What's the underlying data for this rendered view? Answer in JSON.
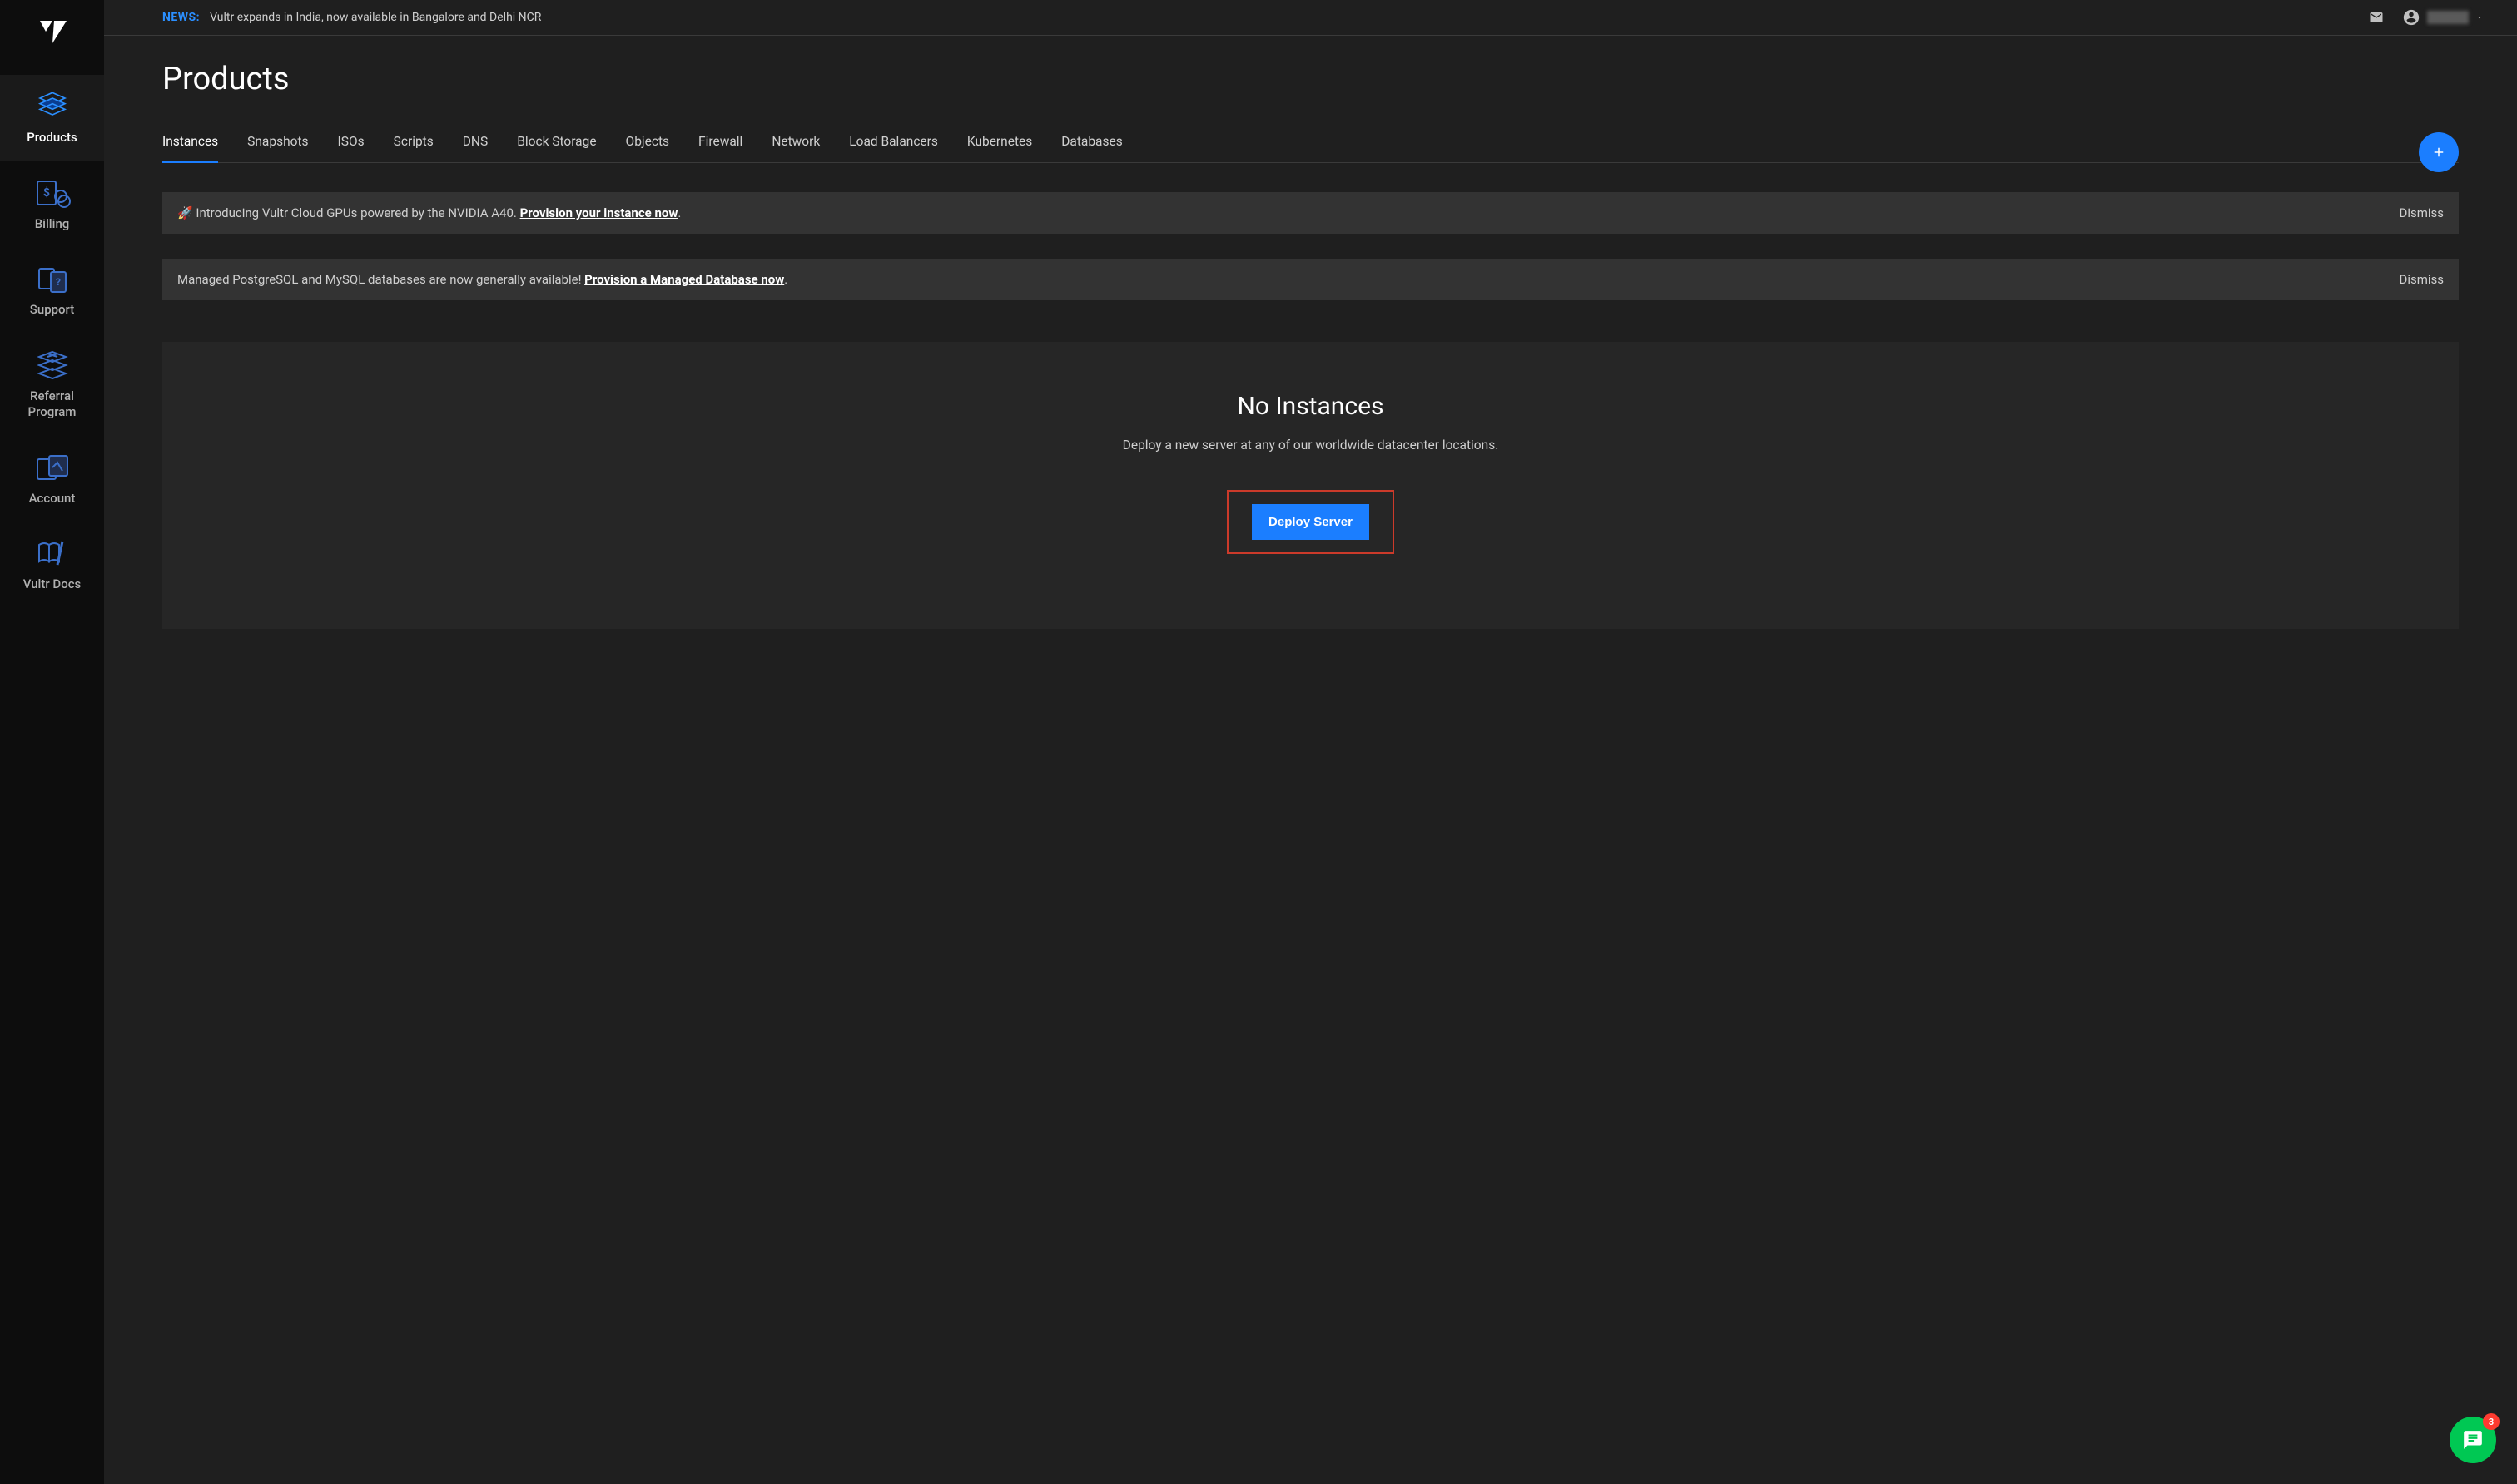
{
  "news": {
    "label": "NEWS:",
    "text": "Vultr expands in India, now available in Bangalore and Delhi NCR"
  },
  "page": {
    "title": "Products"
  },
  "sidebar": {
    "items": [
      {
        "label": "Products"
      },
      {
        "label": "Billing"
      },
      {
        "label": "Support"
      },
      {
        "label": "Referral Program"
      },
      {
        "label": "Account"
      },
      {
        "label": "Vultr Docs"
      }
    ]
  },
  "tabs": [
    {
      "label": "Instances"
    },
    {
      "label": "Snapshots"
    },
    {
      "label": "ISOs"
    },
    {
      "label": "Scripts"
    },
    {
      "label": "DNS"
    },
    {
      "label": "Block Storage"
    },
    {
      "label": "Objects"
    },
    {
      "label": "Firewall"
    },
    {
      "label": "Network"
    },
    {
      "label": "Load Balancers"
    },
    {
      "label": "Kubernetes"
    },
    {
      "label": "Databases"
    }
  ],
  "notices": [
    {
      "prefix": "🚀 Introducing Vultr Cloud GPUs powered by the NVIDIA A40. ",
      "link": "Provision your instance now",
      "suffix": ".",
      "dismiss": "Dismiss"
    },
    {
      "prefix": "Managed PostgreSQL and MySQL databases are now generally available! ",
      "link": "Provision a Managed Database now",
      "suffix": ".",
      "dismiss": "Dismiss"
    }
  ],
  "empty": {
    "title": "No Instances",
    "subtitle": "Deploy a new server at any of our worldwide datacenter locations.",
    "button": "Deploy Server"
  },
  "chat": {
    "badge": "3"
  }
}
